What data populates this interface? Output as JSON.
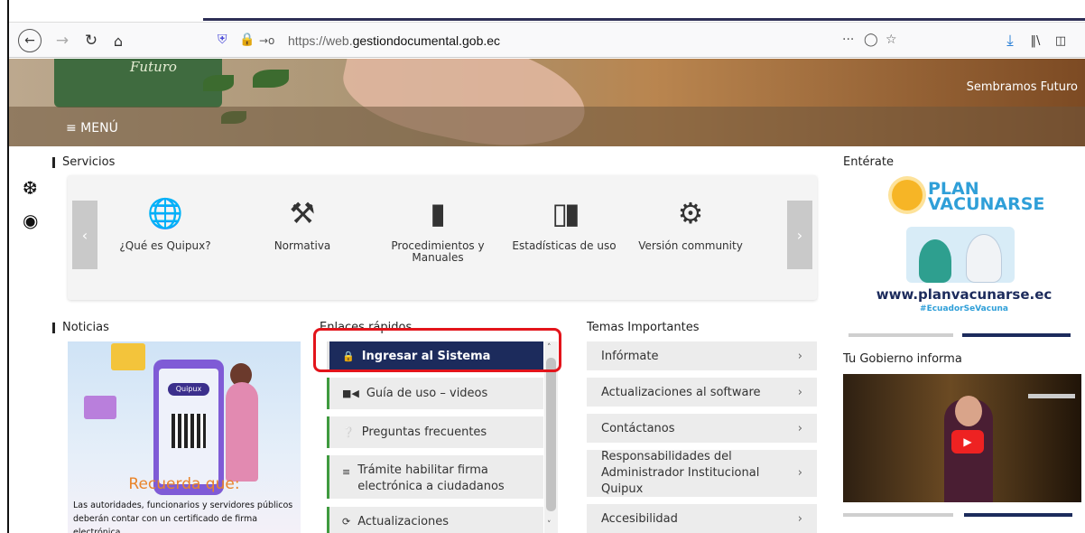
{
  "browser": {
    "url_prefix": "https://web.",
    "url_domain": "gestiondocumental.gob.ec",
    "icons": [
      "back-arrow-icon",
      "forward-arrow-icon",
      "reload-icon",
      "home-icon",
      "shield-icon",
      "lock-icon",
      "key-icon",
      "more-icon",
      "pocket-icon",
      "bookmark-star-icon",
      "download-icon",
      "library-icon",
      "sidebar-icon"
    ]
  },
  "hero": {
    "logo_text": "Futuro",
    "menu_label": "≡ MENÚ",
    "slogan": "Sembramos Futuro"
  },
  "servicios": {
    "title": "Servicios",
    "items": [
      {
        "label": "¿Qué es Quipux?",
        "icon": "globe-icon"
      },
      {
        "label": "Normativa",
        "icon": "gavel-icon"
      },
      {
        "label": "Procedimientos y Manuales",
        "icon": "book-icon"
      },
      {
        "label": "Estadísticas de uso",
        "icon": "bar-chart-icon"
      },
      {
        "label": "Versión community",
        "icon": "users-icon"
      }
    ]
  },
  "noticias": {
    "title": "Noticias",
    "badge": "Quipux",
    "headline": "Recuerda que:",
    "caption": "Las autoridades, funcionarios y servidores públicos deberán contar con un certificado de firma electrónica."
  },
  "enlaces": {
    "title": "Enlaces rápidos",
    "items": [
      {
        "label": "Ingresar al Sistema",
        "icon": "lock-icon",
        "active": true
      },
      {
        "label": "Guía de uso – videos",
        "icon": "video-icon"
      },
      {
        "label": "Preguntas frecuentes",
        "icon": "question-icon"
      },
      {
        "label": "Trámite habilitar firma electrónica a ciudadanos",
        "icon": "list-icon"
      },
      {
        "label": "Actualizaciones",
        "icon": "refresh-icon"
      }
    ]
  },
  "temas": {
    "title": "Temas Importantes",
    "items": [
      {
        "label": "Infórmate"
      },
      {
        "label": "Actualizaciones al software"
      },
      {
        "label": "Contáctanos"
      },
      {
        "label": "Responsabilidades del Administrador Institucional Quipux"
      },
      {
        "label": "Accesibilidad"
      }
    ]
  },
  "enterate": {
    "title": "Entérate",
    "plan_title_line1": "PLAN",
    "plan_title_line2": "VACUNARSE",
    "plan_url": "www.planvacunarse.ec",
    "plan_tag": "#EcuadorSeVacuna"
  },
  "gobierno": {
    "title": "Tu Gobierno informa"
  },
  "colors": {
    "active_link": "#1c2b5c",
    "link_border": "#3f9a3f",
    "highlight": "#e3141b",
    "accent_orange": "#e9842a"
  }
}
